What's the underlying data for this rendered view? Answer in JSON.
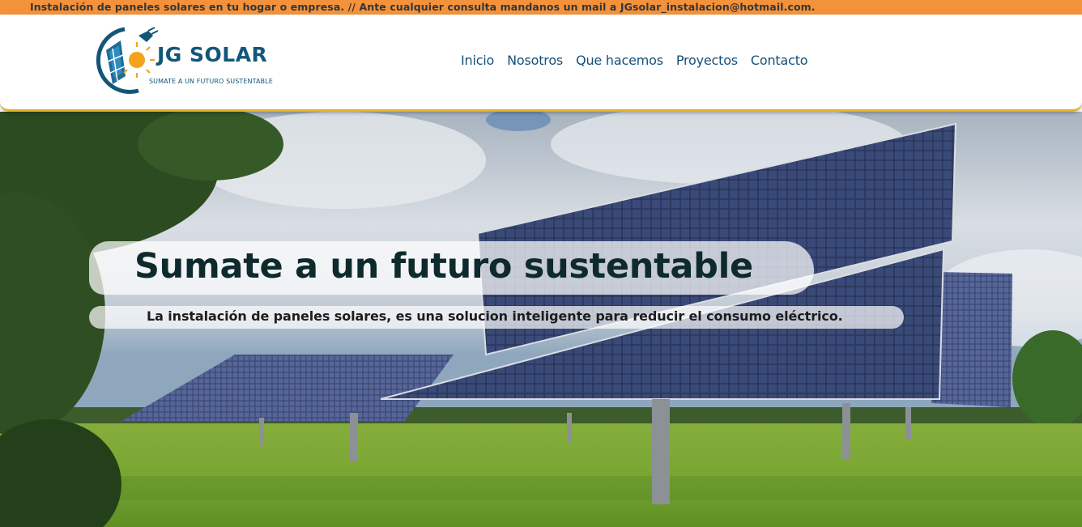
{
  "topbar": {
    "text": "Instalación de paneles solares en tu hogar o empresa. // Ante cualquier consulta mandanos un mail a JGsolar_instalacion@hotmail.com."
  },
  "header": {
    "logo": {
      "name": "JG SOLAR",
      "tagline": "SUMATE A UN FUTURO SUSTENTABLE",
      "icon": "solar-panel-sun-plug-icon"
    },
    "nav": [
      {
        "label": "Inicio"
      },
      {
        "label": "Nosotros"
      },
      {
        "label": "Que hacemos"
      },
      {
        "label": "Proyectos"
      },
      {
        "label": "Contacto"
      }
    ]
  },
  "hero": {
    "title": "Sumate a un futuro sustentable",
    "subtitle": "La instalación de paneles solares, es una solucion inteligente para reducir el consumo eléctrico.",
    "background": "solar-farm-photo"
  },
  "colors": {
    "topbar": "#f4923b",
    "nav_text": "#14507a",
    "brand_blue": "#12567a",
    "header_border": "#e5b023",
    "hero_title": "#0e2a2d"
  }
}
